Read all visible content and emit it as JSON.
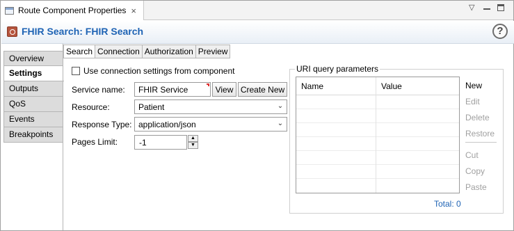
{
  "view_tab": {
    "title": "Route Component Properties",
    "close_glyph": "×",
    "menu_glyph": "▽"
  },
  "header": {
    "title": "FHIR Search: FHIR Search",
    "help_glyph": "?"
  },
  "side_tabs": [
    {
      "label": "Overview",
      "active": false
    },
    {
      "label": "Settings",
      "active": true
    },
    {
      "label": "Outputs",
      "active": false
    },
    {
      "label": "QoS",
      "active": false
    },
    {
      "label": "Events",
      "active": false
    },
    {
      "label": "Breakpoints",
      "active": false
    }
  ],
  "sub_tabs": [
    {
      "label": "Search",
      "active": true
    },
    {
      "label": "Connection",
      "active": false
    },
    {
      "label": "Authorization",
      "active": false
    },
    {
      "label": "Preview",
      "active": false
    }
  ],
  "form": {
    "use_connection_label": "Use connection settings from component",
    "use_connection_checked": false,
    "service_name_label": "Service name:",
    "service_name_value": "FHIR Service",
    "view_button": "View",
    "create_new_button": "Create New",
    "resource_label": "Resource:",
    "resource_value": "Patient",
    "response_type_label": "Response Type:",
    "response_type_value": "application/json",
    "pages_limit_label": "Pages Limit:",
    "pages_limit_value": "-1",
    "dropdown_glyph": "⌄"
  },
  "uri_params": {
    "title": "URI query parameters",
    "columns": [
      "Name",
      "Value"
    ],
    "rows": [],
    "total_text": "Total: 0",
    "actions": [
      {
        "label": "New",
        "enabled": true
      },
      {
        "label": "Edit",
        "enabled": false
      },
      {
        "label": "Delete",
        "enabled": false
      },
      {
        "label": "Restore",
        "enabled": false
      },
      {
        "label": "Cut",
        "enabled": false
      },
      {
        "label": "Copy",
        "enabled": false
      },
      {
        "label": "Paste",
        "enabled": false
      }
    ]
  }
}
